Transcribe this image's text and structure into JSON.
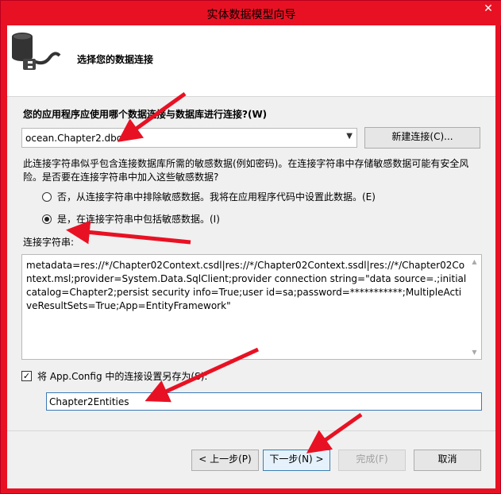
{
  "window": {
    "title": "实体数据模型向导",
    "close_glyph": "✕"
  },
  "header": {
    "title": "选择您的数据连接",
    "icon": "database-connection-icon"
  },
  "connection": {
    "question": "您的应用程序应使用哪个数据连接与数据库进行连接?(W)",
    "selected": "ocean.Chapter2.dbo",
    "new_button": "新建连接(C)...",
    "warning": "此连接字符串似乎包含连接数据库所需的敏感数据(例如密码)。在连接字符串中存储敏感数据可能有安全风险。是否要在连接字符串中加入这些敏感数据?",
    "options": [
      {
        "label": "否，从连接字符串中排除敏感数据。我将在应用程序代码中设置此数据。(E)",
        "checked": false
      },
      {
        "label": "是，在连接字符串中包括敏感数据。(I)",
        "checked": true
      }
    ]
  },
  "conn_string": {
    "label": "连接字符串:",
    "value": "metadata=res://*/Chapter02Context.csdl|res://*/Chapter02Context.ssdl|res://*/Chapter02Context.msl;provider=System.Data.SqlClient;provider connection string=\"data source=.;initial catalog=Chapter2;persist security info=True;user id=sa;password=***********;MultipleActiveResultSets=True;App=EntityFramework\""
  },
  "save": {
    "label": "将 App.Config 中的连接设置另存为(S):",
    "checked": true,
    "value": "Chapter2Entities"
  },
  "footer": {
    "back": "< 上一步(P)",
    "next": "下一步(N) >",
    "finish": "完成(F)",
    "cancel": "取消"
  },
  "accent": {
    "titlebar": "#e81123",
    "annotation_arrow": "#e81123"
  }
}
